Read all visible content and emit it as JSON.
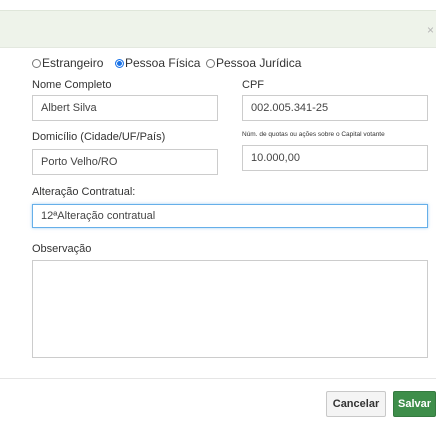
{
  "dialog": {
    "close_glyph": "×"
  },
  "person_type": {
    "options": [
      {
        "label": "Estrangeiro",
        "checked": false
      },
      {
        "label": "Pessoa Física",
        "checked": true
      },
      {
        "label": "Pessoa Jurídica",
        "checked": false
      }
    ]
  },
  "form": {
    "nome_label": "Nome Completo",
    "nome_value": "Albert Silva",
    "cpf_label": "CPF",
    "cpf_value": "002.005.341-25",
    "domicilio_label": "Domicílio (Cidade/UF/País)",
    "domicilio_value": "Porto Velho/RO",
    "quotas_label": "Núm. de quotas ou ações sobre o Capital votante",
    "quotas_value": "10.000,00",
    "alteracao_label": "Alteração Contratual:",
    "alteracao_value": "12ªAlteração contratual",
    "observacao_label": "Observação",
    "observacao_value": ""
  },
  "footer": {
    "cancel_label": "Cancelar",
    "save_label": "Salvar"
  },
  "colors": {
    "header_bg": "#eef3ea",
    "save_bg": "#3e8e4a",
    "radio_checked": "#1a73e8",
    "focus_border": "#66afe9"
  }
}
